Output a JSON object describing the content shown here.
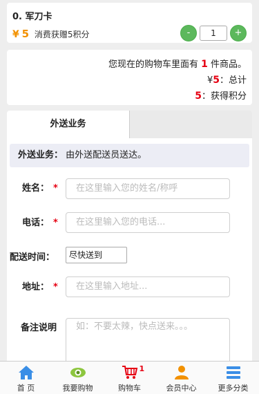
{
  "cart_item": {
    "name": "0. 军刀卡",
    "currency": "¥",
    "price": "5",
    "points_text": "消费获赠5积分",
    "minus_label": "-",
    "quantity": "1",
    "plus_label": "+"
  },
  "summary": {
    "count_prefix": "您现在的购物车里面有",
    "count": "1",
    "count_suffix": "件商品。",
    "currency": "¥",
    "total": "5",
    "total_suffix": "：总计",
    "points": "5",
    "points_suffix": "：获得积分"
  },
  "tabs": [
    {
      "label": "外送业务",
      "active": true
    },
    {
      "label": "",
      "active": false
    }
  ],
  "info": {
    "title": "外送业务：",
    "text": "由外送配送员送达。"
  },
  "form": {
    "name_label": "姓名：",
    "name_placeholder": "在这里输入您的姓名/称呼",
    "phone_label": "电话：",
    "phone_placeholder": "在这里输入您的电话...",
    "time_label": "配送时间：",
    "time_value": "尽快送到",
    "address_label": "地址：",
    "address_placeholder": "在这里输入地址...",
    "note_label": "备注说明",
    "note_placeholder": "如：不要太辣，快点送来。。。",
    "required_mark": "*"
  },
  "bottom_nav": [
    {
      "label": "首 页",
      "icon": "home-icon"
    },
    {
      "label": "我要购物",
      "icon": "eye-icon"
    },
    {
      "label": "购物车",
      "icon": "cart-icon",
      "badge": "1"
    },
    {
      "label": "会员中心",
      "icon": "user-icon"
    },
    {
      "label": "更多分类",
      "icon": "menu-icon"
    }
  ],
  "colors": {
    "accent_orange": "#f29100",
    "highlight_red": "#e60012",
    "stepper_green": "#5cb85c",
    "nav_blue": "#3a8ee6"
  }
}
